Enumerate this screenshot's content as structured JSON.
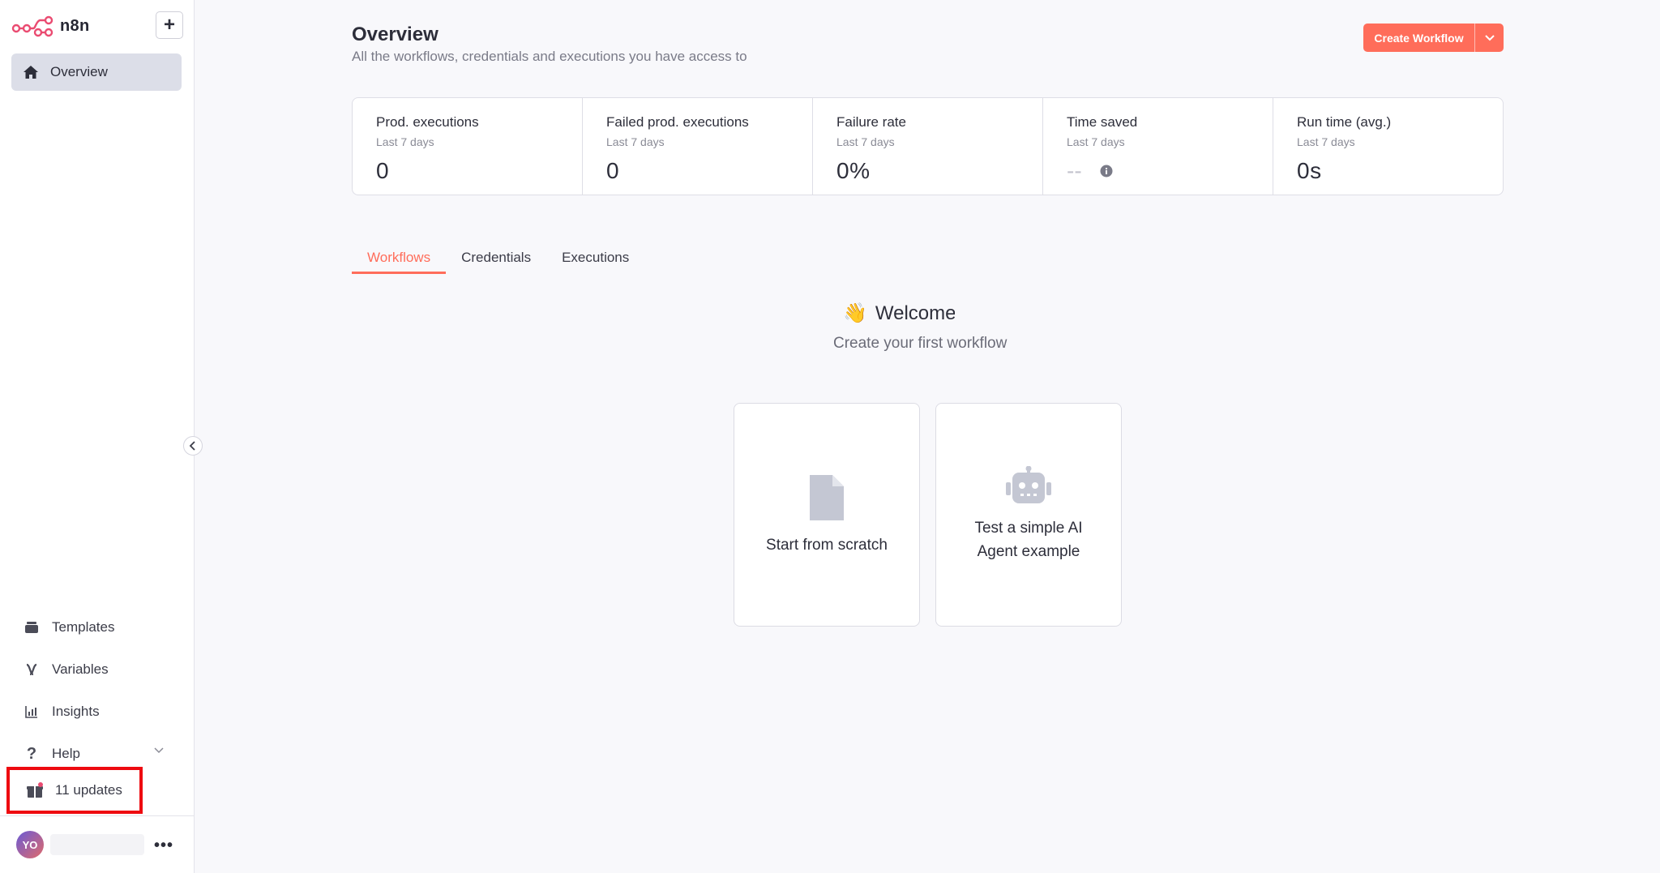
{
  "sidebar": {
    "brand": "n8n",
    "add_label": "+",
    "overview_label": "Overview",
    "bottom_items": [
      {
        "label": "Templates",
        "icon": "templates-icon"
      },
      {
        "label": "Variables",
        "icon": "variables-icon"
      },
      {
        "label": "Insights",
        "icon": "insights-icon"
      },
      {
        "label": "Help",
        "icon": "help-icon"
      }
    ],
    "updates_label": "11 updates",
    "user_initials": "YO"
  },
  "header": {
    "title": "Overview",
    "subtitle": "All the workflows, credentials and executions you have access to",
    "create_label": "Create Workflow"
  },
  "stats": [
    {
      "title": "Prod. executions",
      "period": "Last 7 days",
      "value": "0"
    },
    {
      "title": "Failed prod. executions",
      "period": "Last 7 days",
      "value": "0"
    },
    {
      "title": "Failure rate",
      "period": "Last 7 days",
      "value": "0%"
    },
    {
      "title": "Time saved",
      "period": "Last 7 days",
      "value": "--"
    },
    {
      "title": "Run time (avg.)",
      "period": "Last 7 days",
      "value": "0s"
    }
  ],
  "tabs": [
    {
      "label": "Workflows",
      "active": true
    },
    {
      "label": "Credentials",
      "active": false
    },
    {
      "label": "Executions",
      "active": false
    }
  ],
  "empty_state": {
    "welcome": "Welcome",
    "subtitle": "Create your first workflow",
    "cards": [
      {
        "label": "Start from scratch",
        "icon": "file-icon"
      },
      {
        "label": "Test a simple AI Agent example",
        "icon": "robot-icon"
      }
    ]
  },
  "colors": {
    "accent": "#ff6d5a",
    "highlight_box": "#ee0a10",
    "nav_active_bg": "#dcdee8"
  }
}
